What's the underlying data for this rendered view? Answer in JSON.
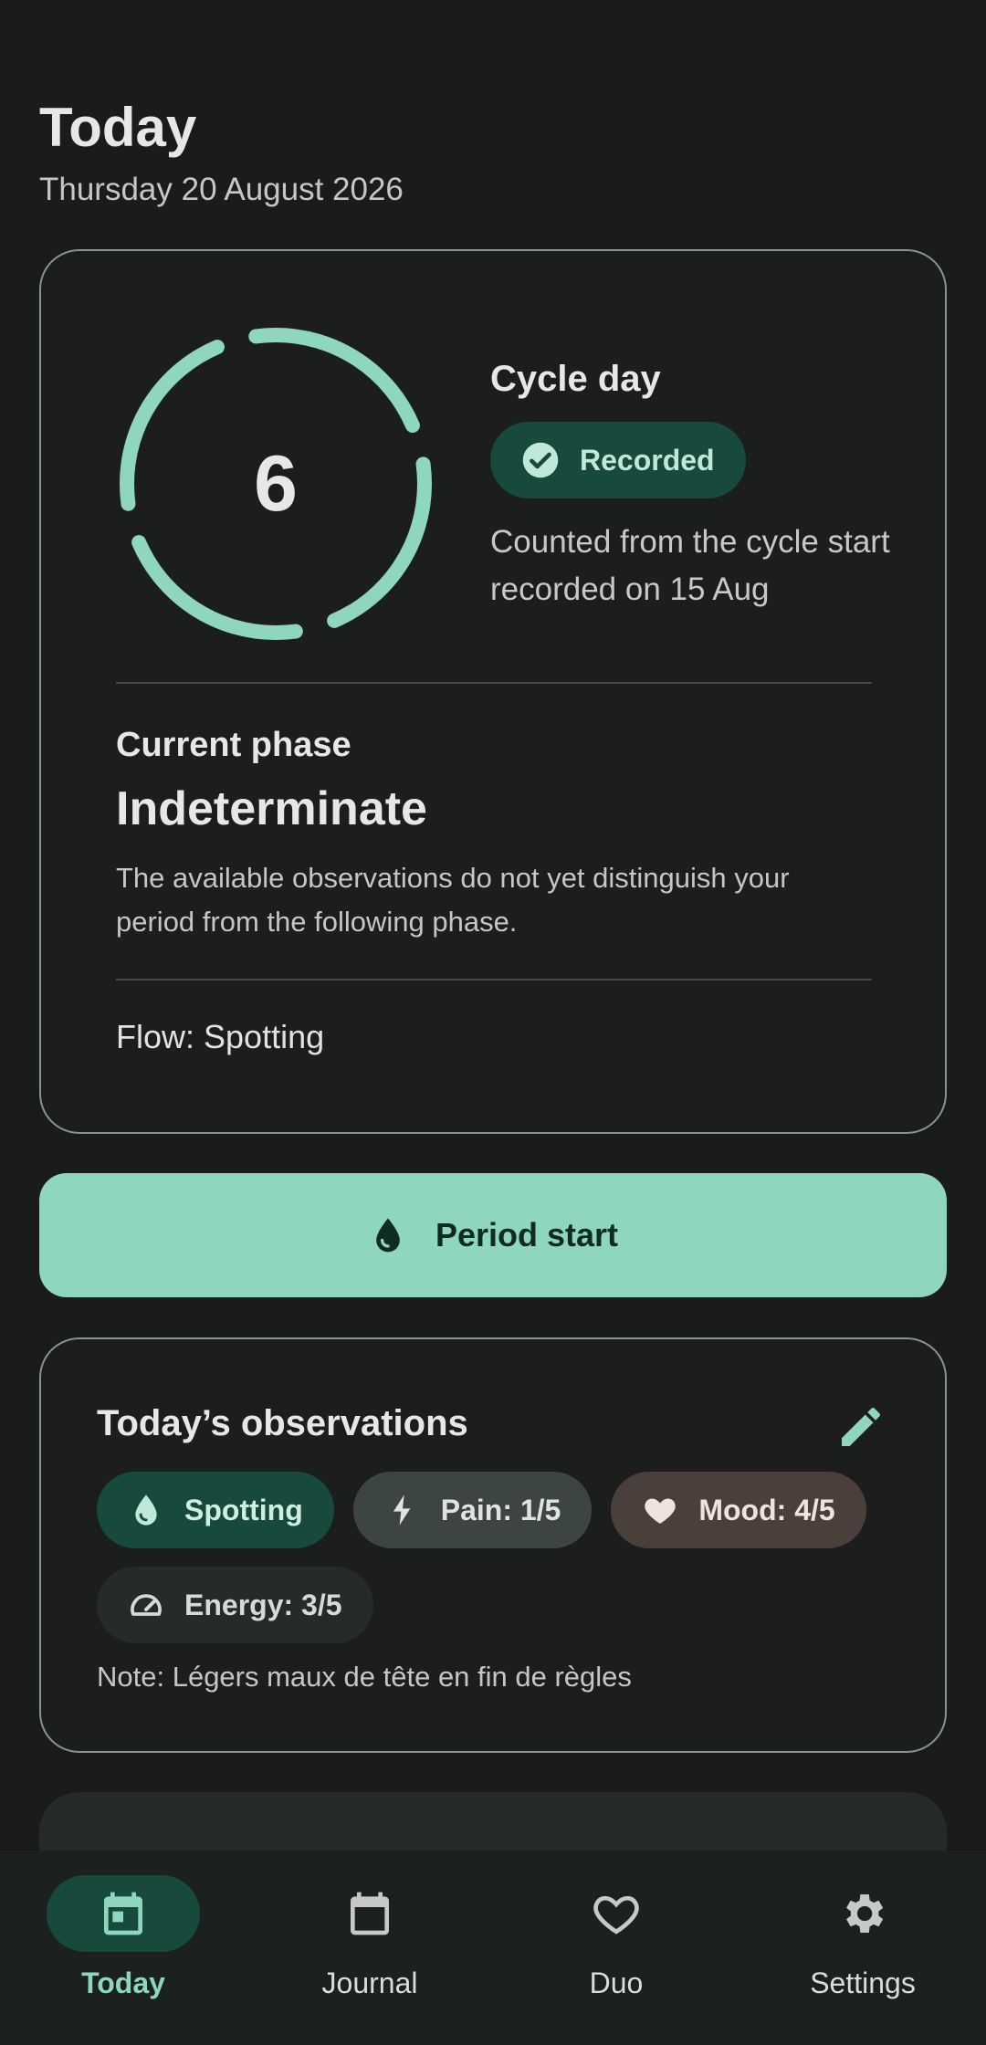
{
  "header": {
    "title": "Today",
    "date": "Thursday 20 August 2026"
  },
  "cycle": {
    "day_number": "6",
    "label": "Cycle day",
    "status_chip": "Recorded",
    "description": "Counted from the cycle start recorded on 15 Aug",
    "phase_label": "Current phase",
    "phase_value": "Indeterminate",
    "phase_description": "The available observations do not yet distinguish your period from the following phase.",
    "flow": "Flow: Spotting"
  },
  "actions": {
    "period_start_label": "Period start"
  },
  "observations": {
    "title": "Today’s observations",
    "chips": {
      "flow": "Spotting",
      "pain": "Pain: 1/5",
      "mood": "Mood: 4/5",
      "energy": "Energy: 3/5"
    },
    "note": "Note: Légers maux de tête en fin de règles"
  },
  "nav": {
    "items": [
      {
        "label": "Today",
        "icon": "calendar-today-icon",
        "active": true
      },
      {
        "label": "Journal",
        "icon": "calendar-icon",
        "active": false
      },
      {
        "label": "Duo",
        "icon": "heart-outline-icon",
        "active": false
      },
      {
        "label": "Settings",
        "icon": "gear-icon",
        "active": false
      }
    ]
  },
  "colors": {
    "accent": "#8fd6bf",
    "accent_container": "#17493c",
    "background": "#191c1b"
  }
}
